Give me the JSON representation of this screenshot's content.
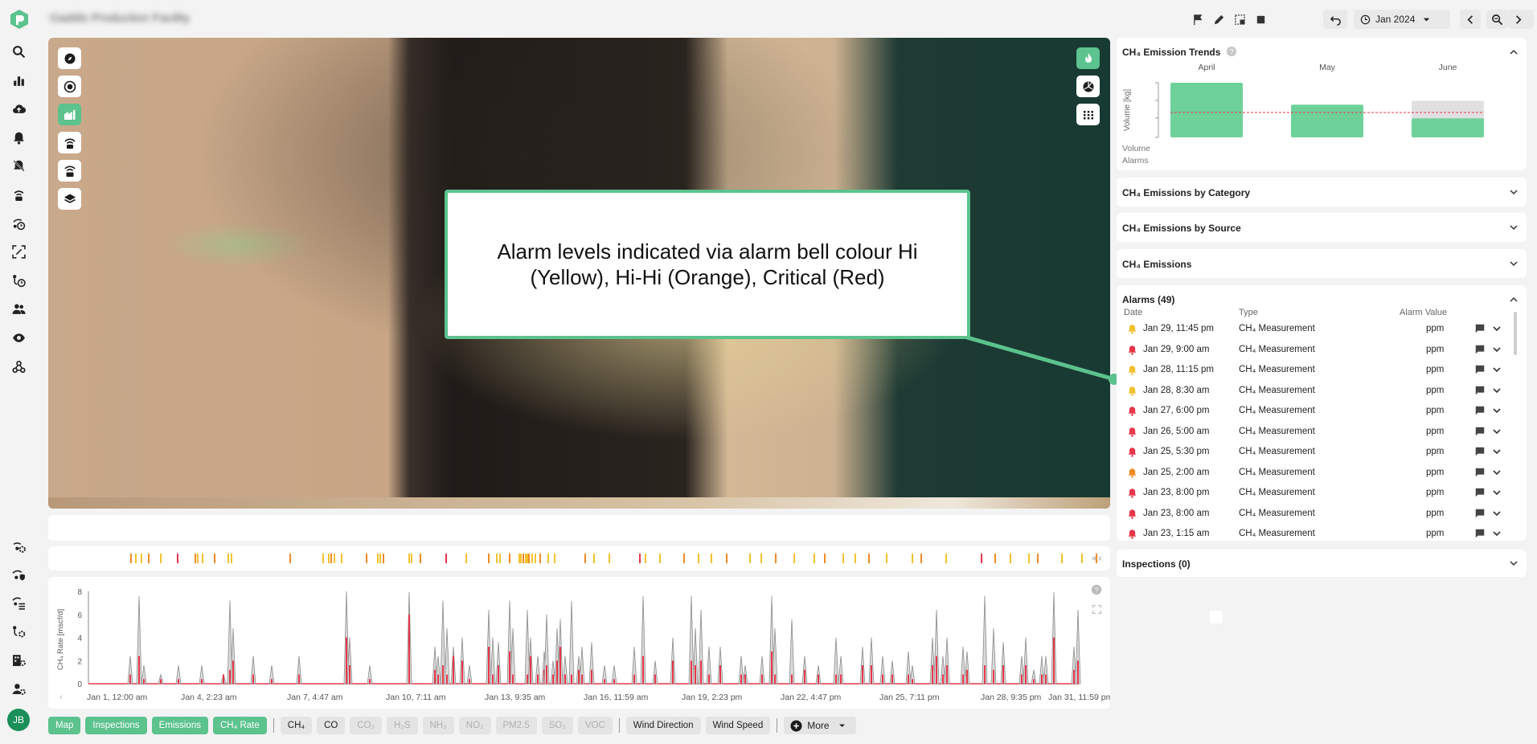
{
  "app": {
    "site_name": "Gaddis Production Facility",
    "user_initials": "JB"
  },
  "toolbar": {
    "date_label": "Jan 2024"
  },
  "callout": {
    "text": "Alarm levels indicated via alarm bell colour Hi (Yellow), Hi-Hi (Orange), Critical (Red)"
  },
  "trends": {
    "title": "CH₄ Emission Trends",
    "months": [
      "April",
      "May",
      "June"
    ],
    "ylabel": "Volume [kg]",
    "legend_volume": "Volume",
    "legend_alarms": "Alarms"
  },
  "sections": {
    "by_category": "CH₄ Emissions by Category",
    "by_source": "CH₄ Emissions by Source",
    "emissions": "CH₄ Emissions",
    "alarms": "Alarms (49)",
    "inspections": "Inspections (0)"
  },
  "alarm_table": {
    "headers": [
      "Date",
      "Type",
      "Alarm Value"
    ],
    "rows": [
      {
        "date": "Jan 29, 11:45 pm",
        "type": "CH₄ Measurement",
        "value": "ppm",
        "level": "hi"
      },
      {
        "date": "Jan 29, 9:00 am",
        "type": "CH₄ Measurement",
        "value": "ppm",
        "level": "critical"
      },
      {
        "date": "Jan 28, 11:15 pm",
        "type": "CH₄ Measurement",
        "value": "ppm",
        "level": "hi"
      },
      {
        "date": "Jan 28, 8:30 am",
        "type": "CH₄ Measurement",
        "value": "ppm",
        "level": "hi"
      },
      {
        "date": "Jan 27, 6:00 pm",
        "type": "CH₄ Measurement",
        "value": "ppm",
        "level": "critical"
      },
      {
        "date": "Jan 26, 5:00 am",
        "type": "CH₄ Measurement",
        "value": "ppm",
        "level": "critical"
      },
      {
        "date": "Jan 25, 5:30 pm",
        "type": "CH₄ Measurement",
        "value": "ppm",
        "level": "critical"
      },
      {
        "date": "Jan 25, 2:00 am",
        "type": "CH₄ Measurement",
        "value": "ppm",
        "level": "hihi"
      },
      {
        "date": "Jan 23, 8:00 pm",
        "type": "CH₄ Measurement",
        "value": "ppm",
        "level": "critical"
      },
      {
        "date": "Jan 23, 8:00 am",
        "type": "CH₄ Measurement",
        "value": "ppm",
        "level": "critical"
      },
      {
        "date": "Jan 23, 1:15 am",
        "type": "CH₄ Measurement",
        "value": "ppm",
        "level": "critical"
      }
    ]
  },
  "level_colors": {
    "hi": "#f2c12e",
    "hihi": "#f08a24",
    "critical": "#e8364a"
  },
  "timeline": {
    "ylabel": "CH₄ Rate [mscf/d]",
    "yticks": [
      "0",
      "2",
      "4",
      "6",
      "8"
    ],
    "xticks": [
      "Jan 1, 12:00 am",
      "Jan 4, 2:23 am",
      "Jan 7, 4:47 am",
      "Jan 10, 7:11 am",
      "Jan 13, 9:35 am",
      "Jan 16, 11:59 am",
      "Jan 19, 2:23 pm",
      "Jan 22, 4:47 pm",
      "Jan 25, 7:11 pm",
      "Jan 28, 9:35 pm",
      "Jan 31, 11:59 pm"
    ]
  },
  "chips": {
    "layers": [
      "Map",
      "Inspections",
      "Emissions",
      "CH₄ Rate"
    ],
    "gases_enabled": [
      "CH₄",
      "CO"
    ],
    "gases_disabled": [
      "CO₂",
      "H₂S",
      "NH₃",
      "NO₂",
      "PM2.5",
      "SO₂",
      "VOC"
    ],
    "weather": [
      "Wind Direction",
      "Wind Speed"
    ],
    "more": "More"
  },
  "chart_data": {
    "type": "bar",
    "title": "CH₄ Emission Trends",
    "categories": [
      "April",
      "May",
      "June"
    ],
    "series": [
      {
        "name": "Volume",
        "values": [
          1.0,
          0.6,
          0.35
        ]
      }
    ],
    "ylabel": "Volume [kg]"
  }
}
